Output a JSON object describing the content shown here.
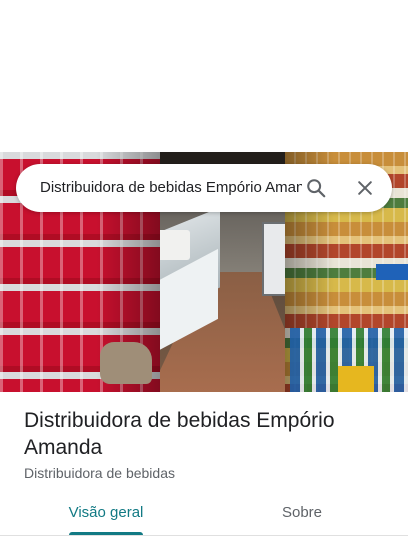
{
  "search": {
    "query": "Distribuidora de bebidas Empório Amanda",
    "search_icon": "search-icon",
    "close_icon": "close-icon"
  },
  "place": {
    "name": "Distribuidora de bebidas Empório Amanda",
    "category": "Distribuidora de bebidas"
  },
  "tabs": [
    {
      "label": "Visão geral",
      "selected": true
    },
    {
      "label": "Sobre",
      "selected": false
    }
  ],
  "colors": {
    "accent": "#127a84",
    "text_primary": "#202124",
    "text_secondary": "#5f6368"
  }
}
